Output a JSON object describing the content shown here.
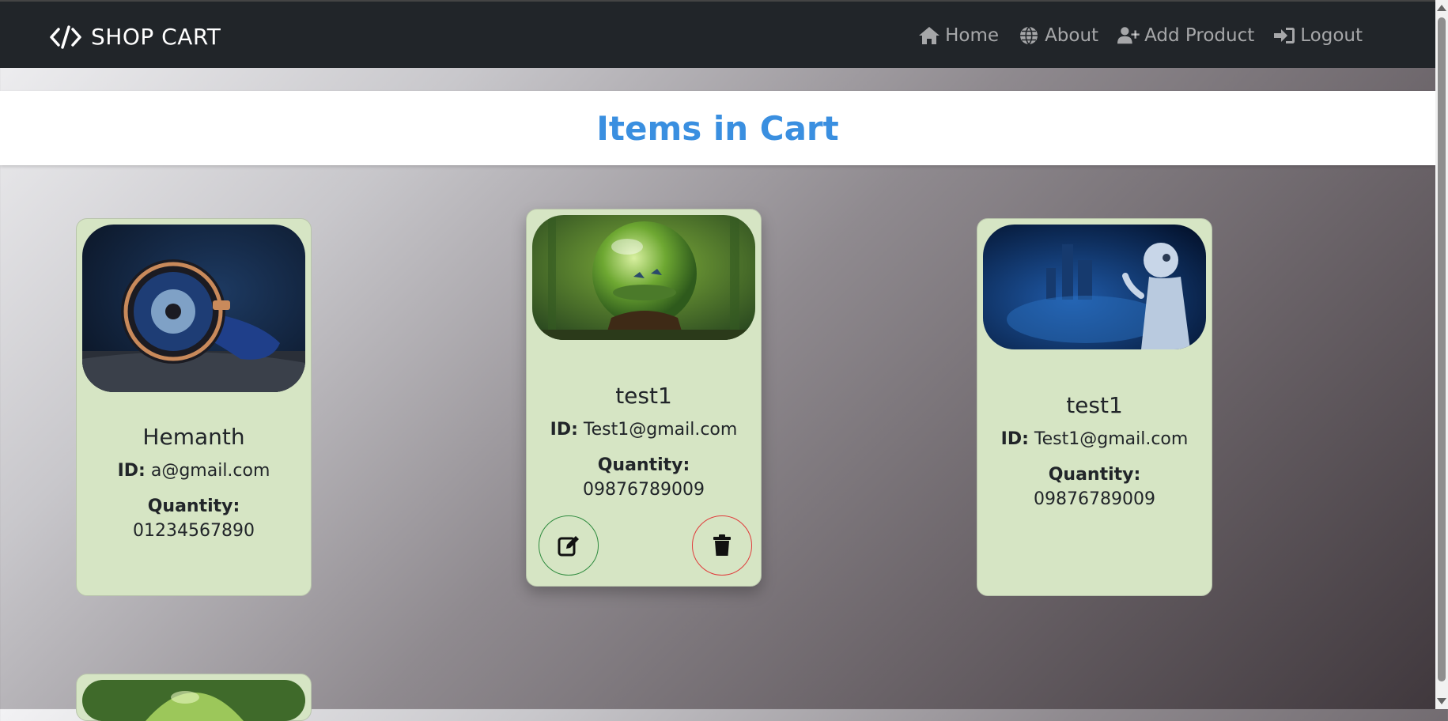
{
  "navbar": {
    "brand": "SHOP CART",
    "links": [
      {
        "label": "Home",
        "icon": "home-icon"
      },
      {
        "label": "About",
        "icon": "globe-icon"
      },
      {
        "label": "Add Product",
        "icon": "user-plus-icon"
      },
      {
        "label": "Logout",
        "icon": "logout-icon"
      }
    ]
  },
  "page": {
    "title": "Items in Cart"
  },
  "cards": [
    {
      "name": "Hemanth",
      "id_label": "ID:",
      "id": "a@gmail.com",
      "quantity_label": "Quantity:",
      "quantity": "01234567890",
      "image": "watch-image"
    },
    {
      "name": "test1",
      "id_label": "ID:",
      "id": "Test1@gmail.com",
      "quantity_label": "Quantity:",
      "quantity": "09876789009",
      "image": "terrarium-image"
    },
    {
      "name": "test1",
      "id_label": "ID:",
      "id": "Test1@gmail.com",
      "quantity_label": "Quantity:",
      "quantity": "09876789009",
      "image": "robot-image"
    }
  ],
  "colors": {
    "navbar_bg": "#212529",
    "title_color": "#3a8fe0",
    "card_bg": "#d6e5c4",
    "edit_border": "#2e8b3e",
    "delete_border": "#e03a3a"
  }
}
